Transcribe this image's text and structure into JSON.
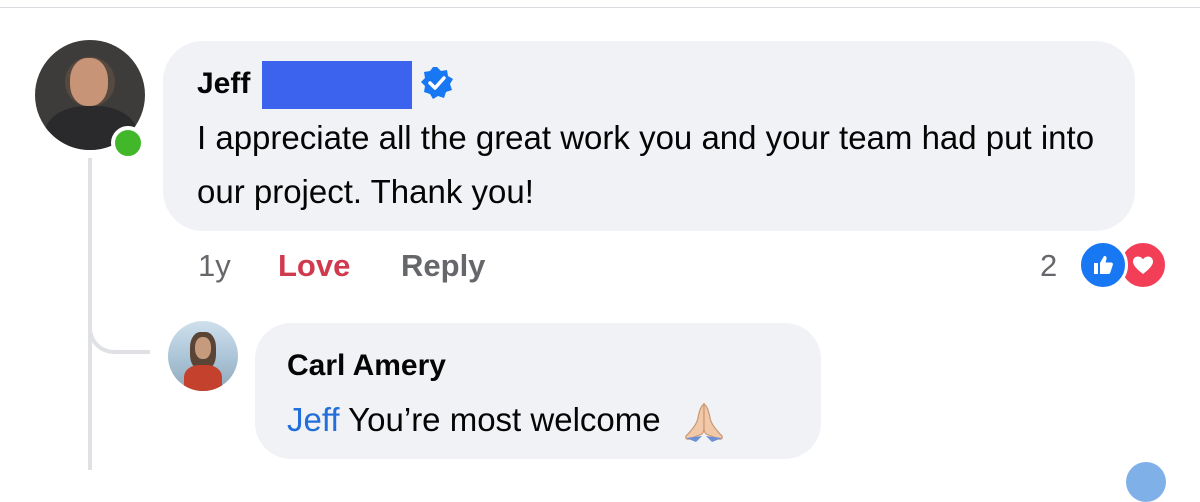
{
  "comment": {
    "author_name": "Jeff",
    "text": "I appreciate all the great work you and your team had put into our project. Thank you!",
    "time": "1y",
    "love_label": "Love",
    "reply_label": "Reply",
    "reaction_count": "2",
    "reaction_icons": [
      "like-icon",
      "love-icon"
    ],
    "author_online": true
  },
  "reply": {
    "author_name": "Carl Amery",
    "mention": "Jeff",
    "text": "You’re most welcome",
    "emoji": "folded-hands-icon"
  },
  "colors": {
    "bubble": "#f0f2f5",
    "love_text": "#d03a4f",
    "mention": "#216fdb",
    "like_blue": "#1877f2",
    "love_red": "#f33e58",
    "online_green": "#42b72a",
    "redaction": "#3b63ee"
  }
}
